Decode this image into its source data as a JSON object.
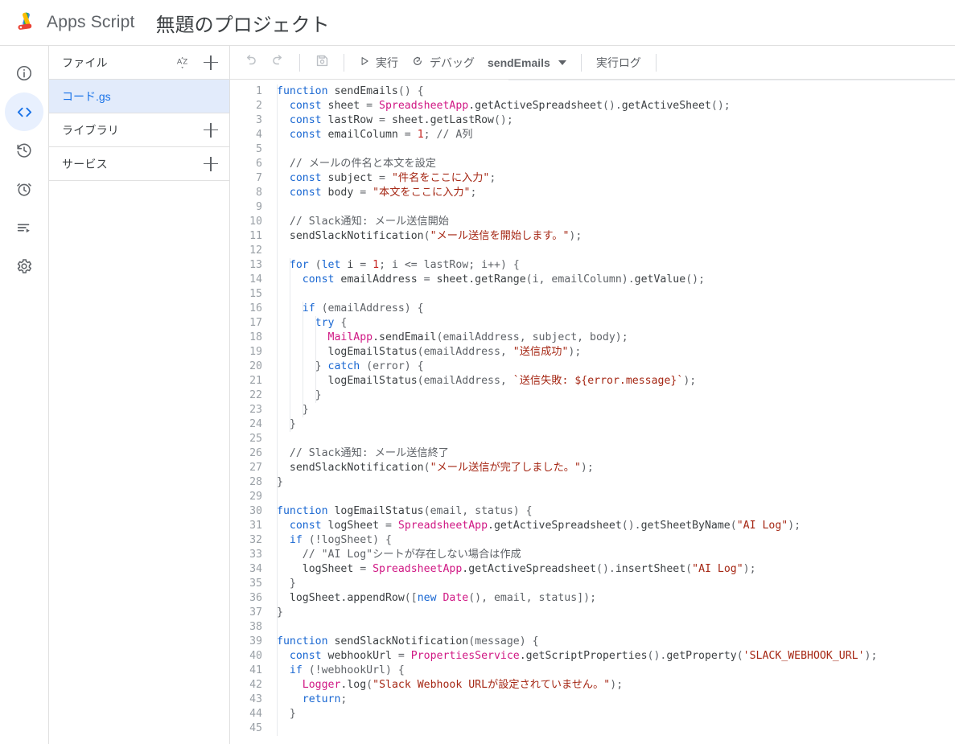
{
  "header": {
    "logo_icon": "apps-script-logo-icon",
    "brand": "Apps Script",
    "project_title": "無題のプロジェクト"
  },
  "rail": {
    "items": [
      {
        "icon": "info-icon",
        "name": "overview",
        "active": false
      },
      {
        "icon": "code-icon",
        "name": "editor",
        "active": true
      },
      {
        "icon": "history-clock-icon",
        "name": "project-history",
        "active": false
      },
      {
        "icon": "alarm-clock-icon",
        "name": "triggers",
        "active": false
      },
      {
        "icon": "executions-list-icon",
        "name": "executions",
        "active": false
      },
      {
        "icon": "gear-icon",
        "name": "project-settings",
        "active": false
      }
    ]
  },
  "file_panel": {
    "files_label": "ファイル",
    "sort_icon": "sort-az-icon",
    "add_icon": "plus-icon",
    "files": [
      {
        "name": "コード.gs",
        "selected": true
      }
    ],
    "libraries_label": "ライブラリ",
    "services_label": "サービス"
  },
  "toolbar": {
    "undo_icon": "undo-icon",
    "redo_icon": "redo-icon",
    "save_icon": "save-floppy-icon",
    "run_label": "実行",
    "run_icon": "play-triangle-icon",
    "debug_label": "デバッグ",
    "debug_icon": "debug-icon",
    "function_name": "sendEmails",
    "function_caret_icon": "chevron-down-icon",
    "exec_log_label": "実行ログ"
  },
  "editor": {
    "lines": [
      {
        "n": 1,
        "tokens": [
          {
            "t": "kw",
            "v": "function"
          },
          {
            "t": "fn",
            "v": " sendEmails"
          },
          {
            "t": "pn",
            "v": "() {"
          }
        ]
      },
      {
        "n": 2,
        "tokens": [
          {
            "t": "kw",
            "v": "  const"
          },
          {
            "t": "fn",
            "v": " sheet "
          },
          {
            "t": "pn",
            "v": "= "
          },
          {
            "t": "cls",
            "v": "SpreadsheetApp"
          },
          {
            "t": "fn",
            "v": ".getActiveSpreadsheet"
          },
          {
            "t": "pn",
            "v": "()."
          },
          {
            "t": "fn",
            "v": "getActiveSheet"
          },
          {
            "t": "pn",
            "v": "();"
          }
        ]
      },
      {
        "n": 3,
        "tokens": [
          {
            "t": "kw",
            "v": "  const"
          },
          {
            "t": "fn",
            "v": " lastRow "
          },
          {
            "t": "pn",
            "v": "= "
          },
          {
            "t": "fn",
            "v": "sheet.getLastRow"
          },
          {
            "t": "pn",
            "v": "();"
          }
        ]
      },
      {
        "n": 4,
        "tokens": [
          {
            "t": "kw",
            "v": "  const"
          },
          {
            "t": "fn",
            "v": " emailColumn "
          },
          {
            "t": "pn",
            "v": "= "
          },
          {
            "t": "num",
            "v": "1"
          },
          {
            "t": "pn",
            "v": "; "
          },
          {
            "t": "cm",
            "v": "// A列"
          }
        ]
      },
      {
        "n": 5,
        "tokens": []
      },
      {
        "n": 6,
        "tokens": [
          {
            "t": "cm",
            "v": "  // メールの件名と本文を設定"
          }
        ]
      },
      {
        "n": 7,
        "tokens": [
          {
            "t": "kw",
            "v": "  const"
          },
          {
            "t": "fn",
            "v": " subject "
          },
          {
            "t": "pn",
            "v": "= "
          },
          {
            "t": "str",
            "v": "\"件名をここに入力\""
          },
          {
            "t": "pn",
            "v": ";"
          }
        ]
      },
      {
        "n": 8,
        "tokens": [
          {
            "t": "kw",
            "v": "  const"
          },
          {
            "t": "fn",
            "v": " body "
          },
          {
            "t": "pn",
            "v": "= "
          },
          {
            "t": "str",
            "v": "\"本文をここに入力\""
          },
          {
            "t": "pn",
            "v": ";"
          }
        ]
      },
      {
        "n": 9,
        "tokens": []
      },
      {
        "n": 10,
        "tokens": [
          {
            "t": "cm",
            "v": "  // Slack通知: メール送信開始"
          }
        ]
      },
      {
        "n": 11,
        "tokens": [
          {
            "t": "fn",
            "v": "  sendSlackNotification"
          },
          {
            "t": "pn",
            "v": "("
          },
          {
            "t": "str",
            "v": "\"メール送信を開始します。\""
          },
          {
            "t": "pn",
            "v": ");"
          }
        ]
      },
      {
        "n": 12,
        "tokens": []
      },
      {
        "n": 13,
        "tokens": [
          {
            "t": "kw",
            "v": "  for"
          },
          {
            "t": "pn",
            "v": " ("
          },
          {
            "t": "kw",
            "v": "let"
          },
          {
            "t": "fn",
            "v": " i "
          },
          {
            "t": "pn",
            "v": "= "
          },
          {
            "t": "num",
            "v": "1"
          },
          {
            "t": "pn",
            "v": "; i <= lastRow; i++) {"
          }
        ]
      },
      {
        "n": 14,
        "tokens": [
          {
            "t": "kw",
            "v": "    const"
          },
          {
            "t": "fn",
            "v": " emailAddress "
          },
          {
            "t": "pn",
            "v": "= "
          },
          {
            "t": "fn",
            "v": "sheet.getRange"
          },
          {
            "t": "pn",
            "v": "(i, emailColumn)."
          },
          {
            "t": "fn",
            "v": "getValue"
          },
          {
            "t": "pn",
            "v": "();"
          }
        ]
      },
      {
        "n": 15,
        "tokens": []
      },
      {
        "n": 16,
        "tokens": [
          {
            "t": "kw",
            "v": "    if"
          },
          {
            "t": "pn",
            "v": " (emailAddress) {"
          }
        ]
      },
      {
        "n": 17,
        "tokens": [
          {
            "t": "kw",
            "v": "      try"
          },
          {
            "t": "pn",
            "v": " {"
          }
        ]
      },
      {
        "n": 18,
        "tokens": [
          {
            "t": "cls",
            "v": "        MailApp"
          },
          {
            "t": "fn",
            "v": ".sendEmail"
          },
          {
            "t": "pn",
            "v": "(emailAddress, subject, body);"
          }
        ]
      },
      {
        "n": 19,
        "tokens": [
          {
            "t": "fn",
            "v": "        logEmailStatus"
          },
          {
            "t": "pn",
            "v": "(emailAddress, "
          },
          {
            "t": "str",
            "v": "\"送信成功\""
          },
          {
            "t": "pn",
            "v": ");"
          }
        ]
      },
      {
        "n": 20,
        "tokens": [
          {
            "t": "pn",
            "v": "      } "
          },
          {
            "t": "kw",
            "v": "catch"
          },
          {
            "t": "pn",
            "v": " (error) {"
          }
        ]
      },
      {
        "n": 21,
        "tokens": [
          {
            "t": "fn",
            "v": "        logEmailStatus"
          },
          {
            "t": "pn",
            "v": "(emailAddress, "
          },
          {
            "t": "str",
            "v": "`送信失敗: ${error.message}`"
          },
          {
            "t": "pn",
            "v": ");"
          }
        ]
      },
      {
        "n": 22,
        "tokens": [
          {
            "t": "pn",
            "v": "      }"
          }
        ]
      },
      {
        "n": 23,
        "tokens": [
          {
            "t": "pn",
            "v": "    }"
          }
        ]
      },
      {
        "n": 24,
        "tokens": [
          {
            "t": "pn",
            "v": "  }"
          }
        ]
      },
      {
        "n": 25,
        "tokens": []
      },
      {
        "n": 26,
        "tokens": [
          {
            "t": "cm",
            "v": "  // Slack通知: メール送信終了"
          }
        ]
      },
      {
        "n": 27,
        "tokens": [
          {
            "t": "fn",
            "v": "  sendSlackNotification"
          },
          {
            "t": "pn",
            "v": "("
          },
          {
            "t": "str",
            "v": "\"メール送信が完了しました。\""
          },
          {
            "t": "pn",
            "v": ");"
          }
        ]
      },
      {
        "n": 28,
        "tokens": [
          {
            "t": "pn",
            "v": "}"
          }
        ]
      },
      {
        "n": 29,
        "tokens": []
      },
      {
        "n": 30,
        "tokens": [
          {
            "t": "kw",
            "v": "function"
          },
          {
            "t": "fn",
            "v": " logEmailStatus"
          },
          {
            "t": "pn",
            "v": "(email, status) {"
          }
        ]
      },
      {
        "n": 31,
        "tokens": [
          {
            "t": "kw",
            "v": "  const"
          },
          {
            "t": "fn",
            "v": " logSheet "
          },
          {
            "t": "pn",
            "v": "= "
          },
          {
            "t": "cls",
            "v": "SpreadsheetApp"
          },
          {
            "t": "fn",
            "v": ".getActiveSpreadsheet"
          },
          {
            "t": "pn",
            "v": "()."
          },
          {
            "t": "fn",
            "v": "getSheetByName"
          },
          {
            "t": "pn",
            "v": "("
          },
          {
            "t": "str",
            "v": "\"AI Log\""
          },
          {
            "t": "pn",
            "v": ");"
          }
        ]
      },
      {
        "n": 32,
        "tokens": [
          {
            "t": "kw",
            "v": "  if"
          },
          {
            "t": "pn",
            "v": " (!logSheet) {"
          }
        ]
      },
      {
        "n": 33,
        "tokens": [
          {
            "t": "cm",
            "v": "    // \"AI Log\"シートが存在しない場合は作成"
          }
        ]
      },
      {
        "n": 34,
        "tokens": [
          {
            "t": "fn",
            "v": "    logSheet "
          },
          {
            "t": "pn",
            "v": "= "
          },
          {
            "t": "cls",
            "v": "SpreadsheetApp"
          },
          {
            "t": "fn",
            "v": ".getActiveSpreadsheet"
          },
          {
            "t": "pn",
            "v": "()."
          },
          {
            "t": "fn",
            "v": "insertSheet"
          },
          {
            "t": "pn",
            "v": "("
          },
          {
            "t": "str",
            "v": "\"AI Log\""
          },
          {
            "t": "pn",
            "v": ");"
          }
        ]
      },
      {
        "n": 35,
        "tokens": [
          {
            "t": "pn",
            "v": "  }"
          }
        ]
      },
      {
        "n": 36,
        "tokens": [
          {
            "t": "fn",
            "v": "  logSheet.appendRow"
          },
          {
            "t": "pn",
            "v": "(["
          },
          {
            "t": "kw",
            "v": "new"
          },
          {
            "t": "cls",
            "v": " Date"
          },
          {
            "t": "pn",
            "v": "(), email, status]);"
          }
        ]
      },
      {
        "n": 37,
        "tokens": [
          {
            "t": "pn",
            "v": "}"
          }
        ]
      },
      {
        "n": 38,
        "tokens": []
      },
      {
        "n": 39,
        "tokens": [
          {
            "t": "kw",
            "v": "function"
          },
          {
            "t": "fn",
            "v": " sendSlackNotification"
          },
          {
            "t": "pn",
            "v": "(message) {"
          }
        ]
      },
      {
        "n": 40,
        "tokens": [
          {
            "t": "kw",
            "v": "  const"
          },
          {
            "t": "fn",
            "v": " webhookUrl "
          },
          {
            "t": "pn",
            "v": "= "
          },
          {
            "t": "cls",
            "v": "PropertiesService"
          },
          {
            "t": "fn",
            "v": ".getScriptProperties"
          },
          {
            "t": "pn",
            "v": "()."
          },
          {
            "t": "fn",
            "v": "getProperty"
          },
          {
            "t": "pn",
            "v": "("
          },
          {
            "t": "str",
            "v": "'SLACK_WEBHOOK_URL'"
          },
          {
            "t": "pn",
            "v": ");"
          }
        ]
      },
      {
        "n": 41,
        "tokens": [
          {
            "t": "kw",
            "v": "  if"
          },
          {
            "t": "pn",
            "v": " (!webhookUrl) {"
          }
        ]
      },
      {
        "n": 42,
        "tokens": [
          {
            "t": "cls",
            "v": "    Logger"
          },
          {
            "t": "fn",
            "v": ".log"
          },
          {
            "t": "pn",
            "v": "("
          },
          {
            "t": "str",
            "v": "\"Slack Webhook URLが設定されていません。\""
          },
          {
            "t": "pn",
            "v": ");"
          }
        ]
      },
      {
        "n": 43,
        "tokens": [
          {
            "t": "kw",
            "v": "    return"
          },
          {
            "t": "pn",
            "v": ";"
          }
        ]
      },
      {
        "n": 44,
        "tokens": [
          {
            "t": "pn",
            "v": "  }"
          }
        ]
      },
      {
        "n": 45,
        "tokens": []
      }
    ]
  },
  "colors": {
    "accent": "#1a73e8",
    "keyword": "#1967d2",
    "class": "#d01884",
    "string": "#a52714",
    "comment": "#5f6368",
    "selection_bg": "#e2ebfb",
    "rail_active_bg": "#e8f0fe"
  }
}
